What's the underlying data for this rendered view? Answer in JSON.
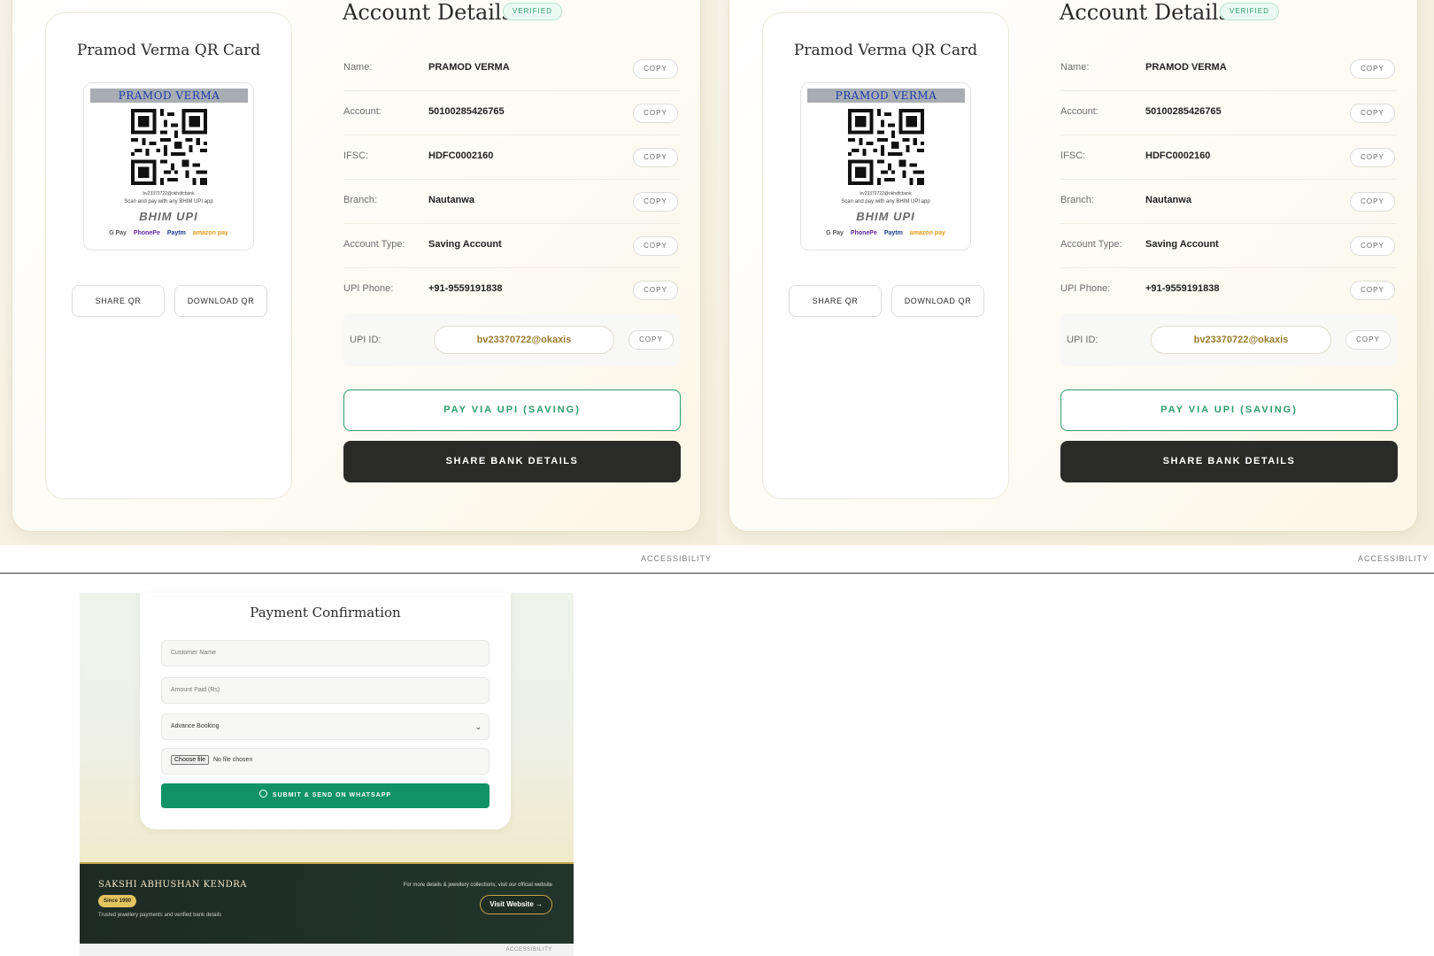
{
  "account_panel": {
    "qr_card": {
      "title": "Pramod Verma QR Card",
      "qr_name_band": "PRAMOD VERMA",
      "qr_vpa": "bv23370722@okhdfcbank",
      "qr_scan_text": "Scan and pay with any BHIM UPI app",
      "qr_bhim_upi": "BHIM UPI",
      "qr_apps": [
        "G Pay",
        "PhonePe",
        "Paytm",
        "amazon pay"
      ],
      "share_qr_label": "SHARE QR",
      "download_qr_label": "DOWNLOAD QR"
    },
    "title": "Account Details",
    "verified_badge": "VERIFIED",
    "rows": [
      {
        "label": "Name:",
        "value": "PRAMOD VERMA",
        "copy": "COPY"
      },
      {
        "label": "Account:",
        "value": "50100285426765",
        "copy": "COPY"
      },
      {
        "label": "IFSC:",
        "value": "HDFC0002160",
        "copy": "COPY"
      },
      {
        "label": "Branch:",
        "value": "Nautanwa",
        "copy": "COPY"
      },
      {
        "label": "Account Type:",
        "value": "Saving Account",
        "copy": "COPY"
      },
      {
        "label": "UPI Phone:",
        "value": "+91-9559191838",
        "copy": "COPY"
      }
    ],
    "upi": {
      "label": "UPI ID:",
      "value": "bv23370722@okaxis",
      "copy": "COPY"
    },
    "pay_button": "PAY VIA UPI (SAVING)",
    "share_button": "SHARE BANK DETAILS",
    "accessibility_link": "ACCESSIBILITY"
  },
  "payment_confirmation": {
    "title": "Payment Confirmation",
    "customer_name_placeholder": "Customer Name",
    "amount_placeholder": "Amount Paid (Rs)",
    "purpose_selected": "Advance Booking",
    "file_button": "Choose file",
    "file_status": "No file chosen",
    "submit_label": "SUBMIT & SEND ON WHATSAPP",
    "footer": {
      "brand": "SAKSHI ABHUSHAN KENDRA",
      "since": "Since 1990",
      "tagline": "Trusted jewellery payments and verified bank details",
      "more_text": "For more details & jewellery collections, visit our official website",
      "visit_button": "Visit Website →"
    },
    "accessibility_link": "ACCESSIBILITY"
  },
  "colors": {
    "accent_green": "#2d9d6c",
    "whatsapp_green": "#129367",
    "dark_button": "#2a2a27",
    "upi_gold": "#9a7a2e",
    "footer_dark": "#1d2b23"
  }
}
